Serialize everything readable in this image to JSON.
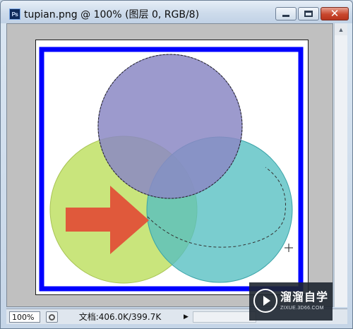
{
  "window": {
    "app_icon": "photoshop-icon",
    "title": "tupian.png @ 100% (图层 0, RGB/8)",
    "buttons": {
      "minimize": "minimize-icon",
      "maximize": "maximize-icon",
      "close": "close-icon",
      "close_glyph": "✕"
    }
  },
  "canvas": {
    "background": "#c0c0c0",
    "document_background": "#ffffff",
    "border_color": "#0000ff",
    "shapes": {
      "purple_circle_color": "#8b88c4",
      "green_circle_color": "#bfe065",
      "teal_circle_color": "#55bfc2",
      "arrow_color": "#e0593b",
      "selection": "marching-ants-selection"
    }
  },
  "status_bar": {
    "zoom": "100%",
    "doc_info": "文档:406.0K/399.7K",
    "play_glyph": "▶"
  },
  "watermark": {
    "title": "溜溜自学",
    "url": "ZIXUE.3D66.COM"
  }
}
